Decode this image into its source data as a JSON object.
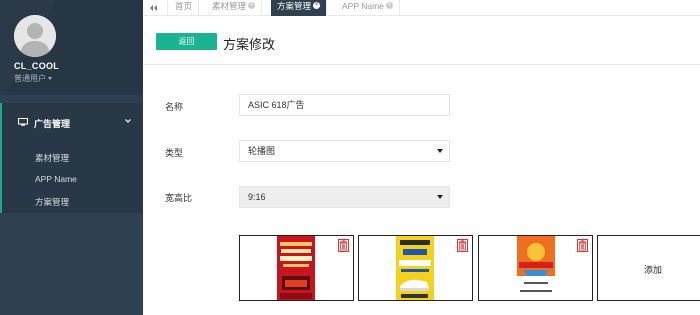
{
  "sidebar": {
    "username": "CL_COOL",
    "role": "普通用户",
    "menu_title": "广告管理",
    "items": [
      {
        "label": "素材管理"
      },
      {
        "label": "APP Name"
      },
      {
        "label": "方案管理"
      }
    ]
  },
  "tabs": [
    {
      "label": "首页",
      "closable": false
    },
    {
      "label": "素材管理",
      "closable": true
    },
    {
      "label": "方案管理",
      "closable": true,
      "active": true
    },
    {
      "label": "APP Name",
      "closable": true
    }
  ],
  "header": {
    "back_label": "返回",
    "title": "方案修改"
  },
  "form": {
    "name_label": "名称",
    "name_value": "ASIC  618广告",
    "type_label": "类型",
    "type_value": "轮播图",
    "ratio_label": "宽高比",
    "ratio_value": "9:16"
  },
  "gallery": {
    "add_label": "添加",
    "images": [
      {
        "alt": "red poster"
      },
      {
        "alt": "yellow poster"
      },
      {
        "alt": "orange poster"
      }
    ]
  },
  "colors": {
    "sidebar": "#2f4050",
    "accent": "#1ab394",
    "trash": "#e3312e"
  }
}
